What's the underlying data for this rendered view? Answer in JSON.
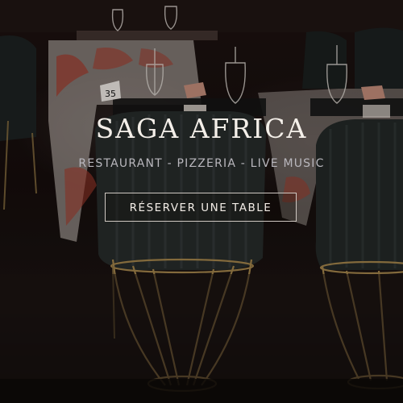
{
  "hero": {
    "title": "SAGA AFRICA",
    "subtitle": "RESTAURANT - PIZZERIA - LIVE MUSIC",
    "cta_label": "RÉSERVER UNE TABLE",
    "table_number": "35"
  },
  "colors": {
    "title": "#f4efe9",
    "subtitle": "#b9b7bd",
    "button_border": "#cfc8c2",
    "background": "#120c0b"
  }
}
